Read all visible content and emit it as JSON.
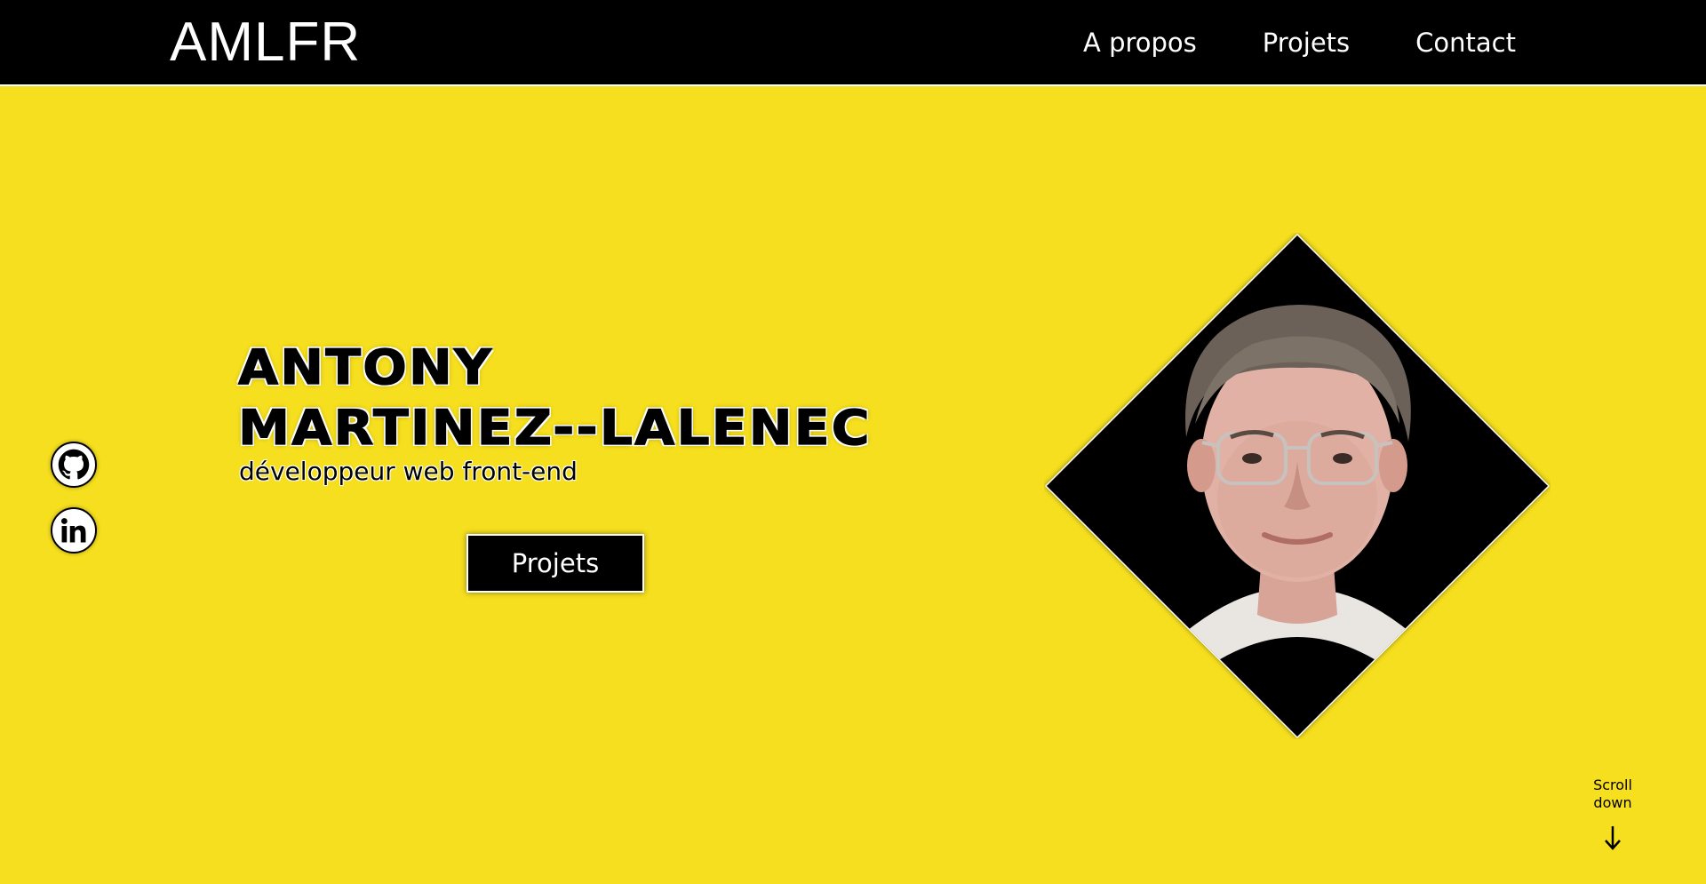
{
  "header": {
    "brand": "AMLFR",
    "nav": [
      {
        "label": "A propos"
      },
      {
        "label": "Projets"
      },
      {
        "label": "Contact"
      }
    ]
  },
  "social": [
    {
      "name": "github",
      "icon": "github-icon"
    },
    {
      "name": "linkedin",
      "icon": "linkedin-icon"
    }
  ],
  "hero": {
    "name_line1": "ANTONY",
    "name_line2": "MARTINEZ--LALENEC",
    "role": "développeur web front-end",
    "cta_label": "Projets"
  },
  "portrait": {
    "icon": "profile-photo"
  },
  "scroll": {
    "line1": "Scroll",
    "line2": "down",
    "icon": "arrow-down-icon"
  },
  "colors": {
    "background": "#f6df1e",
    "header": "#000000",
    "text_light": "#ffffff",
    "text_dark": "#000000"
  }
}
